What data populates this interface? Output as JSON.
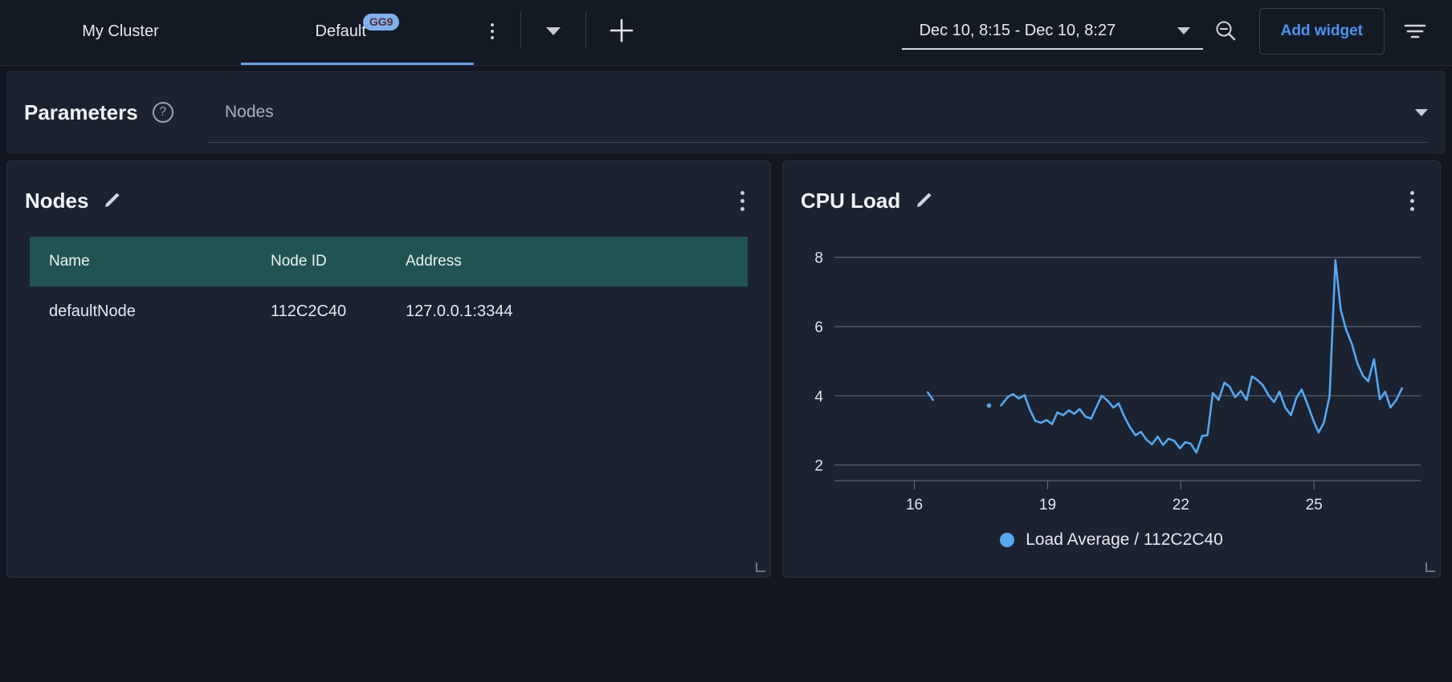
{
  "topbar": {
    "tabs": [
      {
        "label": "My Cluster",
        "active": false,
        "badge": null
      },
      {
        "label": "Default",
        "active": true,
        "badge": "GG9"
      }
    ],
    "kebab_icon": "more-vertical-icon",
    "dropdown_icon": "chevron-down-icon",
    "add_tab_icon": "plus-icon",
    "date_range": "Dec 10, 8:15 - Dec 10, 8:27",
    "date_range_caret_icon": "caret-down-icon",
    "zoom_out_icon": "zoom-out-icon",
    "add_widget_label": "Add widget",
    "filter_icon": "filter-icon",
    "accent_color": "#4d93f0",
    "badge_bg": "#7fb0f2",
    "badge_fg": "#5a2b2b"
  },
  "parameters": {
    "label": "Parameters",
    "help_icon": "question-circle-icon",
    "select_value": "Nodes",
    "select_caret_icon": "caret-down-icon"
  },
  "panels": {
    "nodes": {
      "title": "Nodes",
      "edit_icon": "pencil-icon",
      "menu_icon": "more-vertical-icon",
      "resize_icon": "resize-handle-icon",
      "header_bg": "#215450",
      "table": {
        "columns": [
          "Name",
          "Node ID",
          "Address"
        ],
        "rows": [
          [
            "defaultNode",
            "112C2C40",
            "127.0.0.1:3344"
          ]
        ]
      }
    },
    "cpu": {
      "title": "CPU Load",
      "edit_icon": "pencil-icon",
      "menu_icon": "more-vertical-icon",
      "legend_label": "Load Average / 112C2C40",
      "legend_color": "#54a8f0"
    }
  },
  "chart_data": {
    "type": "line",
    "title": "CPU Load",
    "xlabel": "",
    "ylabel": "",
    "xlim": [
      14.2,
      27.4
    ],
    "ylim": [
      1.55,
      8.55
    ],
    "yticks": [
      2,
      4,
      6,
      8
    ],
    "xticks": [
      16,
      19,
      22,
      25
    ],
    "grid": true,
    "legend_position": "bottom-center",
    "series": [
      {
        "name": "Load Average / 112C2C40",
        "color": "#54a8f0",
        "x": [
          16.3,
          16.42,
          17.95,
          18.1,
          18.22,
          18.35,
          18.48,
          18.6,
          18.72,
          18.85,
          18.98,
          19.1,
          19.22,
          19.35,
          19.48,
          19.6,
          19.72,
          19.85,
          19.98,
          20.1,
          20.22,
          20.35,
          20.48,
          20.6,
          20.72,
          20.85,
          20.98,
          21.1,
          21.22,
          21.35,
          21.48,
          21.6,
          21.72,
          21.85,
          21.98,
          22.1,
          22.22,
          22.35,
          22.48,
          22.6,
          22.72,
          22.85,
          22.98,
          23.1,
          23.22,
          23.35,
          23.48,
          23.6,
          23.72,
          23.85,
          23.98,
          24.1,
          24.22,
          24.35,
          24.48,
          24.6,
          24.72,
          24.85,
          24.98,
          25.1,
          25.22,
          25.35,
          25.48,
          25.6,
          25.72,
          25.85,
          25.98,
          26.1,
          26.22,
          26.35,
          26.48,
          26.6,
          26.72,
          26.85,
          26.98
        ],
        "y": [
          4.1,
          3.88,
          3.72,
          3.96,
          4.05,
          3.92,
          4.02,
          3.6,
          3.28,
          3.22,
          3.3,
          3.18,
          3.52,
          3.44,
          3.58,
          3.48,
          3.62,
          3.4,
          3.34,
          3.68,
          4.0,
          3.86,
          3.66,
          3.78,
          3.42,
          3.1,
          2.86,
          2.96,
          2.74,
          2.6,
          2.82,
          2.58,
          2.76,
          2.7,
          2.48,
          2.66,
          2.62,
          2.36,
          2.84,
          2.86,
          4.08,
          3.88,
          4.38,
          4.26,
          3.96,
          4.14,
          3.88,
          4.56,
          4.46,
          4.3,
          4.0,
          3.82,
          4.12,
          3.66,
          3.44,
          3.94,
          4.18,
          3.76,
          3.3,
          2.94,
          3.22,
          4.0,
          7.92,
          6.48,
          5.92,
          5.5,
          4.92,
          4.58,
          4.42,
          5.06,
          3.9,
          4.12,
          3.66,
          3.88,
          4.22
        ]
      }
    ],
    "markers": [
      {
        "x": 17.68,
        "y": 3.72,
        "kind": "point"
      }
    ]
  }
}
